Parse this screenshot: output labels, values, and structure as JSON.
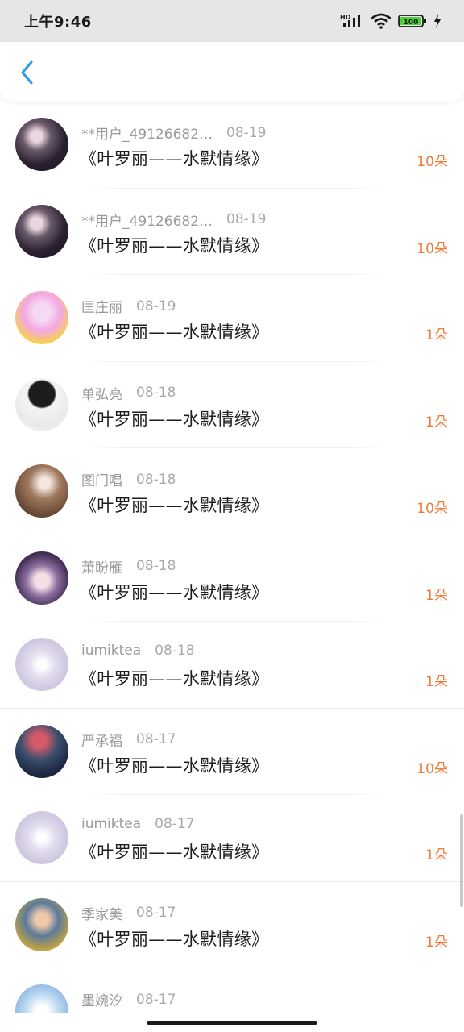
{
  "status_bar": {
    "time": "上午9:46",
    "hd_label": "HD",
    "battery_level": "100",
    "icons": [
      "signal-icon",
      "wifi-icon",
      "battery-icon",
      "charging-icon"
    ]
  },
  "nav": {
    "back_icon": "chevron-left-icon",
    "accent_color": "#2b9af3"
  },
  "colors": {
    "amount": "#f07b3a",
    "meta": "#9a9a9a",
    "title": "#1e1e1e"
  },
  "rows": [
    {
      "name": "**用户_49126682…",
      "date": "08-19",
      "title": "《叶罗丽——水默情缘》",
      "amount": "10朵"
    },
    {
      "name": "**用户_49126682…",
      "date": "08-19",
      "title": "《叶罗丽——水默情缘》",
      "amount": "10朵"
    },
    {
      "name": "匡庄丽",
      "date": "08-19",
      "title": "《叶罗丽——水默情缘》",
      "amount": "1朵"
    },
    {
      "name": "单弘亮",
      "date": "08-18",
      "title": "《叶罗丽——水默情缘》",
      "amount": "1朵"
    },
    {
      "name": "图门唱",
      "date": "08-18",
      "title": "《叶罗丽——水默情缘》",
      "amount": "10朵"
    },
    {
      "name": "萧盼雁",
      "date": "08-18",
      "title": "《叶罗丽——水默情缘》",
      "amount": "1朵"
    },
    {
      "name": "iumiktea",
      "date": "08-18",
      "title": "《叶罗丽——水默情缘》",
      "amount": "1朵"
    },
    {
      "name": "严承福",
      "date": "08-17",
      "title": "《叶罗丽——水默情缘》",
      "amount": "10朵"
    },
    {
      "name": "iumiktea",
      "date": "08-17",
      "title": "《叶罗丽——水默情缘》",
      "amount": "1朵"
    },
    {
      "name": "季家美",
      "date": "08-17",
      "title": "《叶罗丽——水默情缘》",
      "amount": "1朵"
    },
    {
      "name": "墨婉汐",
      "date": "08-17",
      "title": "",
      "amount": ""
    }
  ]
}
